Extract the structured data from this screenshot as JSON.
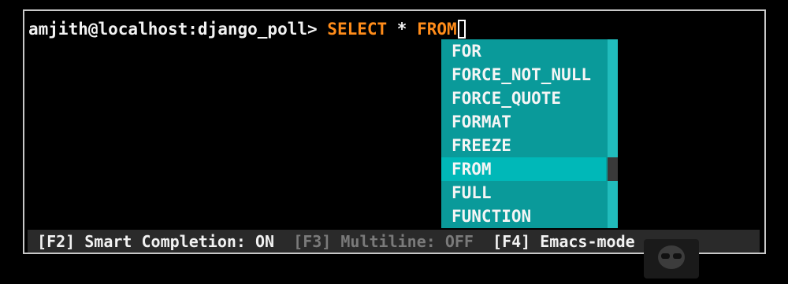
{
  "prompt": {
    "user_host_db": "amjith@localhost:django_poll> ",
    "keyword_select": "SELECT",
    "star": " * ",
    "keyword_from": "FROM"
  },
  "completion_menu": {
    "items": [
      "FOR",
      "FORCE_NOT_NULL",
      "FORCE_QUOTE",
      "FORMAT",
      "FREEZE",
      "FROM",
      "FULL",
      "FUNCTION"
    ],
    "selected": "FROM"
  },
  "status_bar": {
    "smart_completion": "[F2] Smart Completion: ON",
    "multiline": "[F3] Multiline: OFF",
    "edit_mode": "[F4] Emacs-mode"
  },
  "colors": {
    "keyword": "#ff8c1a",
    "menu_bg": "#0a9a9a",
    "menu_selected": "#00b8b8",
    "status_bg": "#2a2a2a",
    "disabled_text": "#7a7a7a"
  }
}
